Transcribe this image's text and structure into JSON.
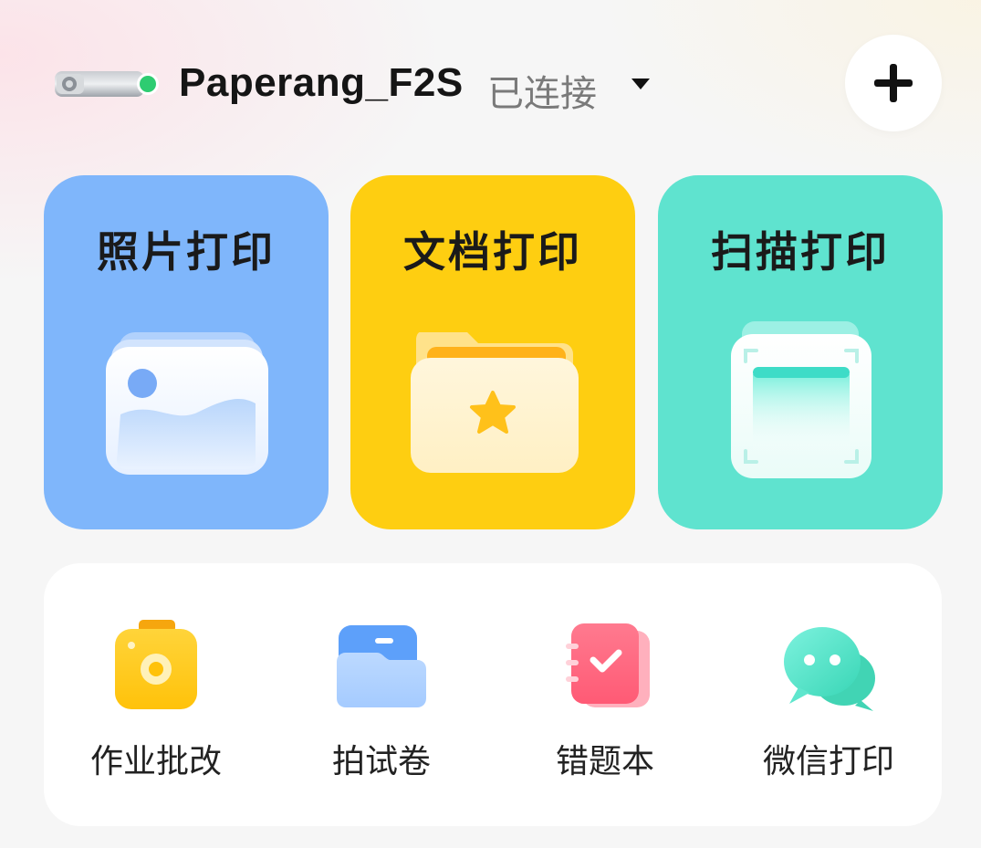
{
  "header": {
    "device_name": "Paperang_F2S",
    "status": "已连接",
    "status_color": "#2ecc71",
    "dropdown_icon": "caret-down-icon",
    "add_icon": "plus-icon"
  },
  "cards": [
    {
      "title": "照片打印",
      "icon": "photo-stack-icon",
      "color": "#7fb6fb"
    },
    {
      "title": "文档打印",
      "icon": "folder-star-icon",
      "color": "#fece11"
    },
    {
      "title": "扫描打印",
      "icon": "scan-frame-icon",
      "color": "#5fe3cf"
    }
  ],
  "tools": [
    {
      "label": "作业批改",
      "icon": "camera-icon"
    },
    {
      "label": "拍试卷",
      "icon": "folder-icon"
    },
    {
      "label": "错题本",
      "icon": "notebook-check-icon"
    },
    {
      "label": "微信打印",
      "icon": "chat-bubbles-icon"
    }
  ]
}
